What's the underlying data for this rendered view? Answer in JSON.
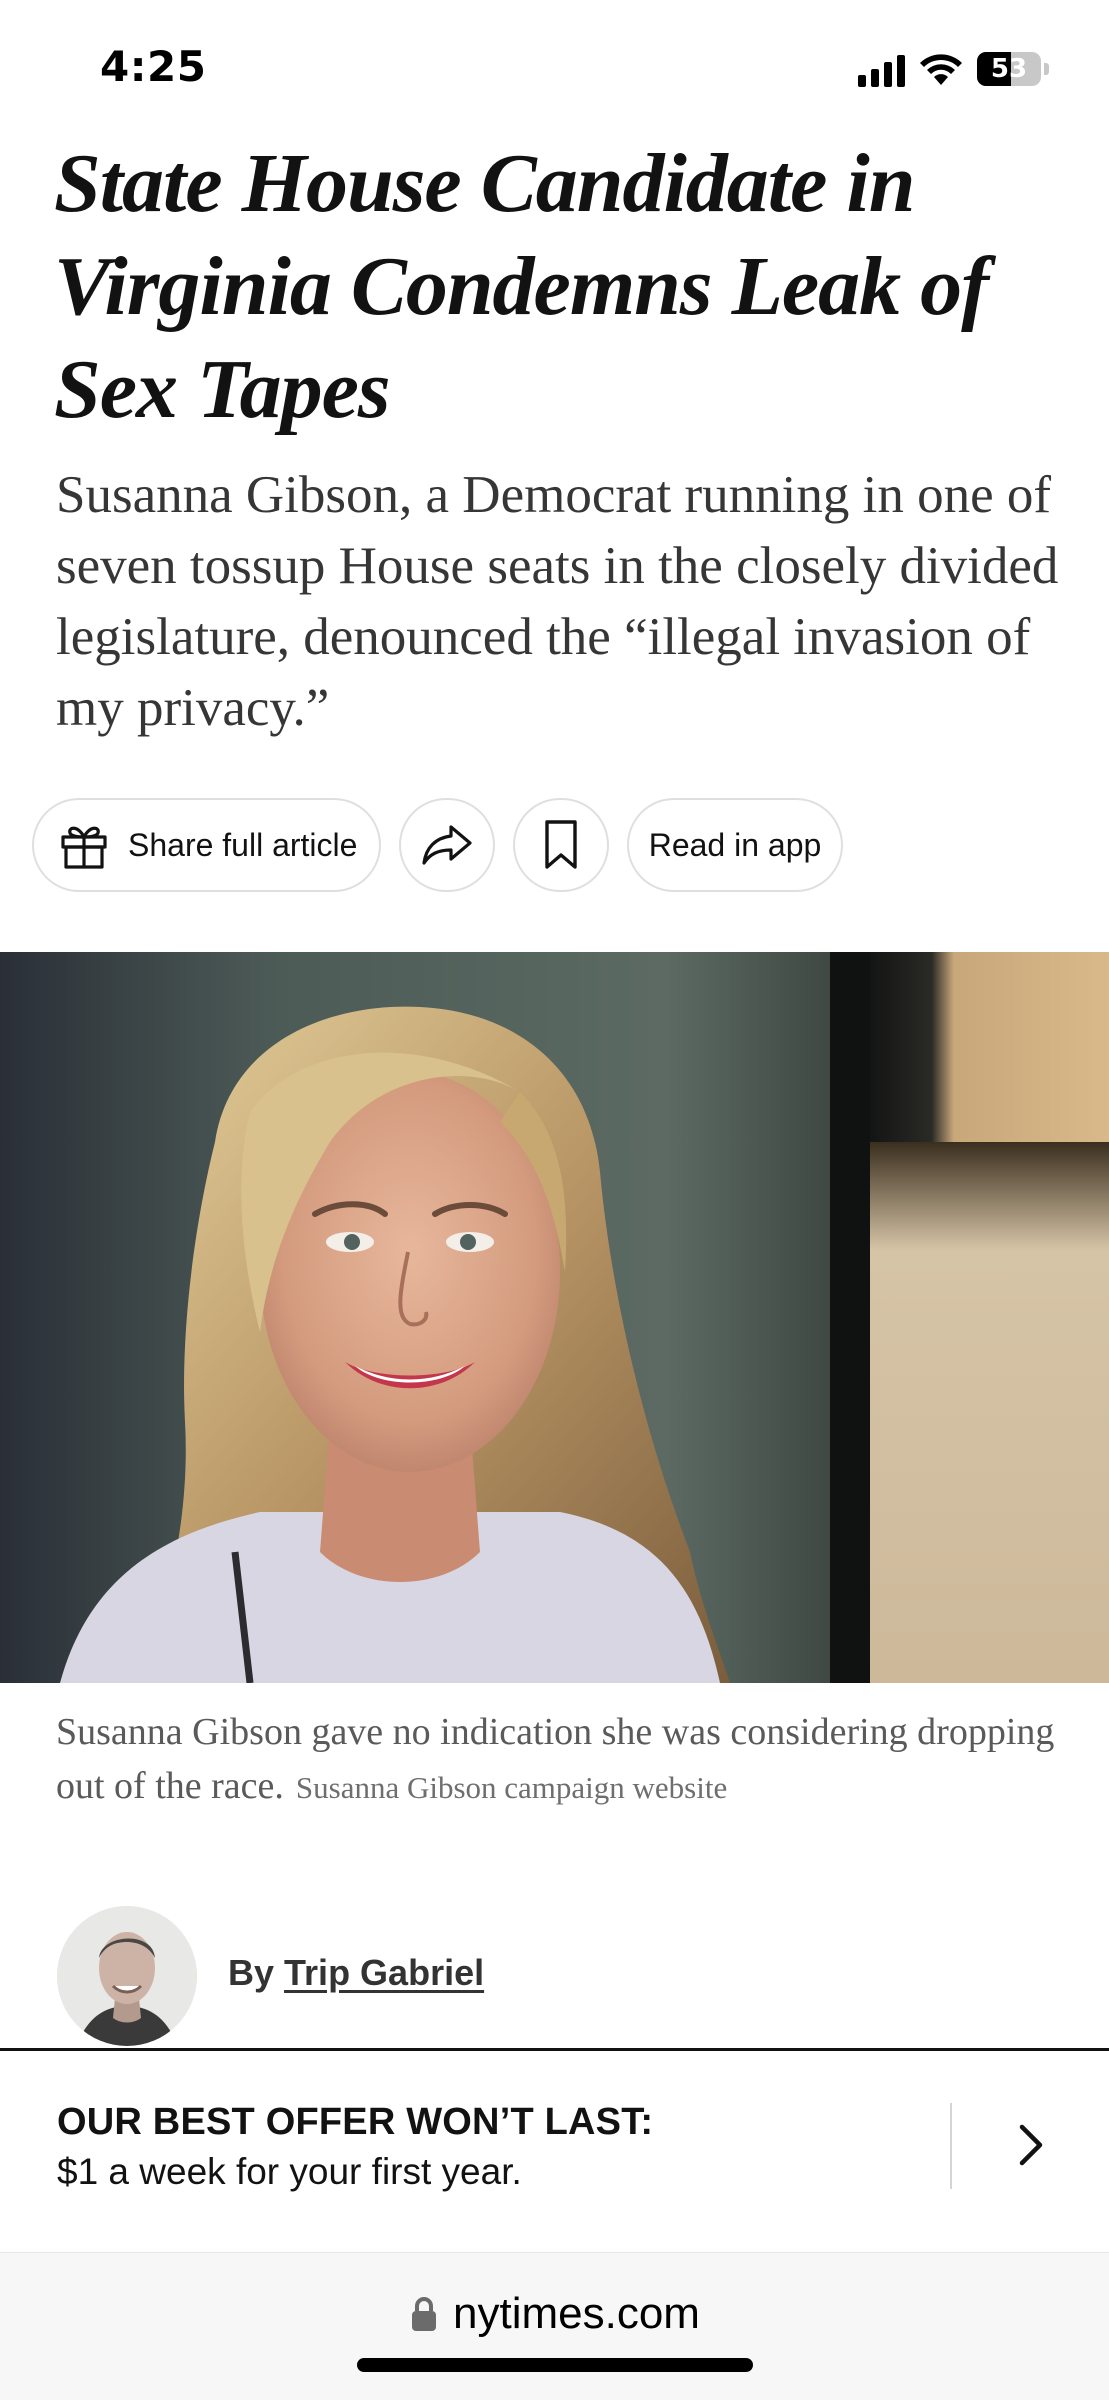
{
  "status_bar": {
    "time": "4:25",
    "battery_level": "53",
    "battery_fraction": 0.53,
    "icons": [
      "signal-icon",
      "wifi-icon",
      "battery-icon"
    ]
  },
  "article": {
    "headline": "State House Candidate in Virginia Condemns Leak of Sex Tapes",
    "summary": "Susanna Gibson, a Democrat running in one of seven tossup House seats in the closely divided legislature, denounced the “illegal invasion of my privacy.”",
    "caption": "Susanna Gibson gave no indication she was considering dropping out of the race.",
    "caption_credit": "Susanna Gibson campaign website",
    "byline_prefix": "By",
    "author": "Trip Gabriel"
  },
  "actions": {
    "share_label": "Share full article",
    "read_in_app_label": "Read in app",
    "icons": [
      "gift-icon",
      "share-arrow-icon",
      "bookmark-icon"
    ]
  },
  "offer": {
    "title": "OUR BEST OFFER WON’T LAST:",
    "subtitle": "$1 a week for your first year."
  },
  "browser": {
    "url": "nytimes.com"
  },
  "colors": {
    "text": "#121212",
    "summary_text": "#363636",
    "caption_text": "#5a5a5a",
    "button_border": "#dfdfdf",
    "url_bar_bg": "#f7f7f7"
  }
}
